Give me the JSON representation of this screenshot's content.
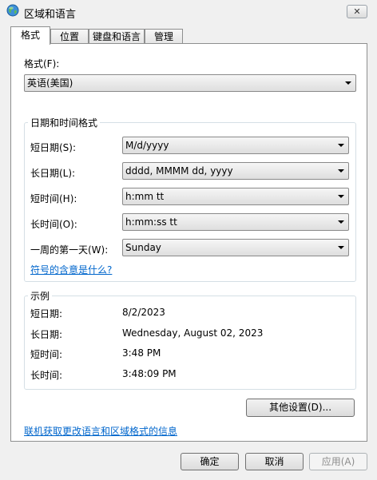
{
  "window": {
    "title": "区域和语言",
    "close_glyph": "✕"
  },
  "tabs": [
    {
      "label": "格式",
      "active": true
    },
    {
      "label": "位置",
      "active": false
    },
    {
      "label": "键盘和语言",
      "active": false
    },
    {
      "label": "管理",
      "active": false
    }
  ],
  "format": {
    "label": "格式(F):",
    "value": "英语(美国)"
  },
  "datetime": {
    "title": "日期和时间格式",
    "short_date": {
      "label": "短日期(S):",
      "value": "M/d/yyyy"
    },
    "long_date": {
      "label": "长日期(L):",
      "value": "dddd, MMMM dd, yyyy"
    },
    "short_time": {
      "label": "短时间(H):",
      "value": "h:mm tt"
    },
    "long_time": {
      "label": "长时间(O):",
      "value": "h:mm:ss tt"
    },
    "first_day": {
      "label": "一周的第一天(W):",
      "value": "Sunday"
    },
    "symbol_link": "符号的含意是什么?"
  },
  "examples": {
    "title": "示例",
    "rows": [
      {
        "label": "短日期:",
        "value": "8/2/2023"
      },
      {
        "label": "长日期:",
        "value": "Wednesday, August 02, 2023"
      },
      {
        "label": "短时间:",
        "value": "3:48 PM"
      },
      {
        "label": "长时间:",
        "value": "3:48:09 PM"
      }
    ]
  },
  "more_settings_label": "其他设置(D)...",
  "online_link": "联机获取更改语言和区域格式的信息",
  "footer": {
    "ok": "确定",
    "cancel": "取消",
    "apply": "应用(A)"
  },
  "icons": {
    "window": "globe-icon",
    "dropdown": "chevron-down-icon",
    "close": "close-icon"
  }
}
